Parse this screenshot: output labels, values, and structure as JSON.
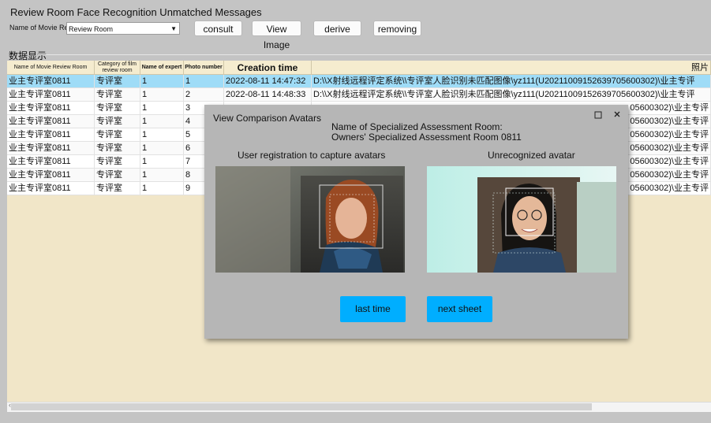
{
  "window": {
    "title": "Review Room Face Recognition Unmatched Messages"
  },
  "filter": {
    "label": "Name of Movie Review Room",
    "selected": "Review Room",
    "consult": "consult",
    "view_image": "View Image",
    "derive": "derive",
    "removing": "removing"
  },
  "group": {
    "label": "数据显示"
  },
  "table": {
    "headers": {
      "room": "Name of Movie Review Room",
      "category_1": "Category of film",
      "category_2": "review room",
      "expert": "Name of expert",
      "photo": "Photo number",
      "created": "Creation time",
      "image": "照片"
    },
    "rows": [
      {
        "room": "业主专评室0811",
        "category": "专评室",
        "expert": "1",
        "photo": "1",
        "created": "2022-08-11 14:47:32",
        "path": "D:\\\\X射线远程评定系统\\\\专评室人脸识别未匹配图像\\yz111(U20211009152639705600302)\\业主专评"
      },
      {
        "room": "业主专评室0811",
        "category": "专评室",
        "expert": "1",
        "photo": "2",
        "created": "2022-08-11 14:48:33",
        "path": "D:\\\\X射线远程评定系统\\\\专评室人脸识别未匹配图像\\yz111(U20211009152639705600302)\\业主专评"
      },
      {
        "room": "业主专评室0811",
        "category": "专评室",
        "expert": "1",
        "photo": "3",
        "created": "",
        "path": "05600302)\\业主专评"
      },
      {
        "room": "业主专评室0811",
        "category": "专评室",
        "expert": "1",
        "photo": "4",
        "created": "",
        "path": "05600302)\\业主专评"
      },
      {
        "room": "业主专评室0811",
        "category": "专评室",
        "expert": "1",
        "photo": "5",
        "created": "",
        "path": "05600302)\\业主专评"
      },
      {
        "room": "业主专评室0811",
        "category": "专评室",
        "expert": "1",
        "photo": "6",
        "created": "",
        "path": "05600302)\\业主专评"
      },
      {
        "room": "业主专评室0811",
        "category": "专评室",
        "expert": "1",
        "photo": "7",
        "created": "",
        "path": "05600302)\\业主专评"
      },
      {
        "room": "业主专评室0811",
        "category": "专评室",
        "expert": "1",
        "photo": "8",
        "created": "",
        "path": "05600302)\\业主专评"
      },
      {
        "room": "业主专评室0811",
        "category": "专评室",
        "expert": "1",
        "photo": "9",
        "created": "",
        "path": "05600302)\\业主专评"
      }
    ]
  },
  "dialog": {
    "title": "View Comparison Avatars",
    "room_label": "Name of Specialized Assessment Room:",
    "room_name": "Owners' Specialized Assessment Room 0811",
    "left_caption": "User registration to capture avatars",
    "right_caption": "Unrecognized avatar",
    "prev": "last time",
    "next": "next sheet",
    "maximize_icon": "square-icon",
    "close_icon": "close-icon"
  },
  "colors": {
    "selected_row": "#9fdcf7",
    "dialog_button": "#00aeff",
    "table_bg": "#f1e6c8"
  }
}
